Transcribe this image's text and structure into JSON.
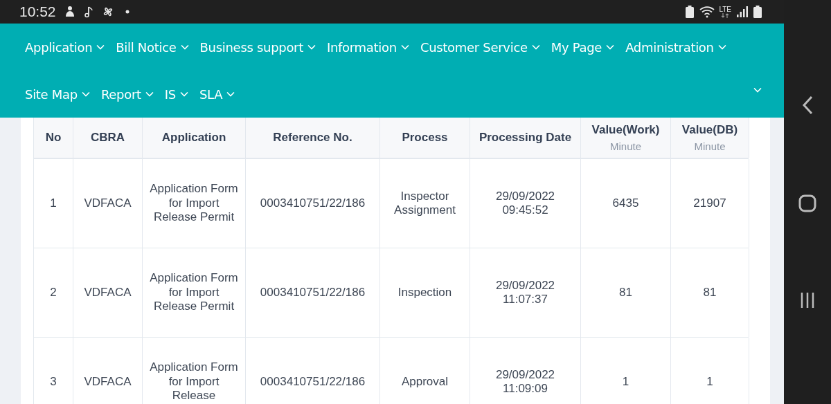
{
  "status_bar": {
    "time": "10:52",
    "network": "LTE"
  },
  "menu": [
    {
      "label": "Application"
    },
    {
      "label": "Bill Notice"
    },
    {
      "label": "Business support"
    },
    {
      "label": "Information"
    },
    {
      "label": "Customer Service"
    },
    {
      "label": "My Page"
    },
    {
      "label": "Administration"
    },
    {
      "label": "Site Map"
    },
    {
      "label": "Report"
    },
    {
      "label": "IS"
    },
    {
      "label": "SLA"
    }
  ],
  "table": {
    "columns": [
      {
        "label": "No"
      },
      {
        "label": "CBRA"
      },
      {
        "label": "Application"
      },
      {
        "label": "Reference No."
      },
      {
        "label": "Process"
      },
      {
        "label": "Processing Date"
      },
      {
        "label": "Value(Work)",
        "unit": "Minute"
      },
      {
        "label": "Value(DB)",
        "unit": "Minute"
      }
    ],
    "rows": [
      [
        "1",
        "VDFACA",
        "Application Form for Import Release Permit",
        "0003410751/22/186",
        "Inspector Assignment",
        "29/09/2022 09:45:52",
        "6435",
        "21907"
      ],
      [
        "2",
        "VDFACA",
        "Application Form for Import Release Permit",
        "0003410751/22/186",
        "Inspection",
        "29/09/2022 11:07:37",
        "81",
        "81"
      ],
      [
        "3",
        "VDFACA",
        "Application Form for Import Release",
        "0003410751/22/186",
        "Approval",
        "29/09/2022 11:09:09",
        "1",
        "1"
      ]
    ]
  }
}
